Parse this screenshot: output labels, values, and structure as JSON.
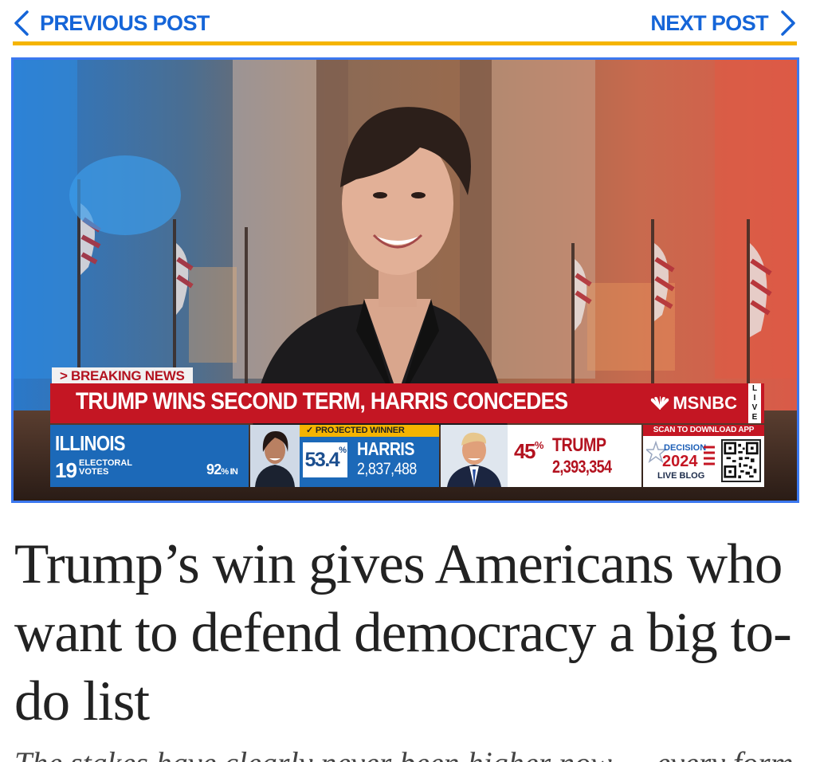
{
  "nav": {
    "previous_label": "PREVIOUS POST",
    "next_label": "NEXT POST",
    "accent_color": "#f5b400",
    "link_color": "#1565d8"
  },
  "hero": {
    "breaking_tab": "> BREAKING NEWS",
    "headline": "TRUMP WINS SECOND TERM, HARRIS CONCEDES",
    "network": "MSNBC",
    "live_letters": [
      "L",
      "I",
      "V",
      "E"
    ],
    "state": {
      "name": "ILLINOIS",
      "electoral_votes": "19",
      "electoral_label": "ELECTORAL VOTES",
      "percent_in": "92",
      "percent_in_label": "% IN"
    },
    "projected_label": "PROJECTED WINNER",
    "harris": {
      "share": "53.4",
      "share_unit": "%",
      "name": "HARRIS",
      "votes": "2,837,488"
    },
    "trump": {
      "share": "45",
      "share_unit": "%",
      "name": "TRUMP",
      "votes": "2,393,354"
    },
    "app": {
      "scan_label": "SCAN TO DOWNLOAD APP",
      "decision_label": "DECISION",
      "year": "2024",
      "blog_label": "LIVE BLOG"
    }
  },
  "article": {
    "title": "Trump’s win gives Americans who want to defend democracy a big to-do list",
    "dek": "The stakes have clearly never been higher now — every form of resistance"
  }
}
